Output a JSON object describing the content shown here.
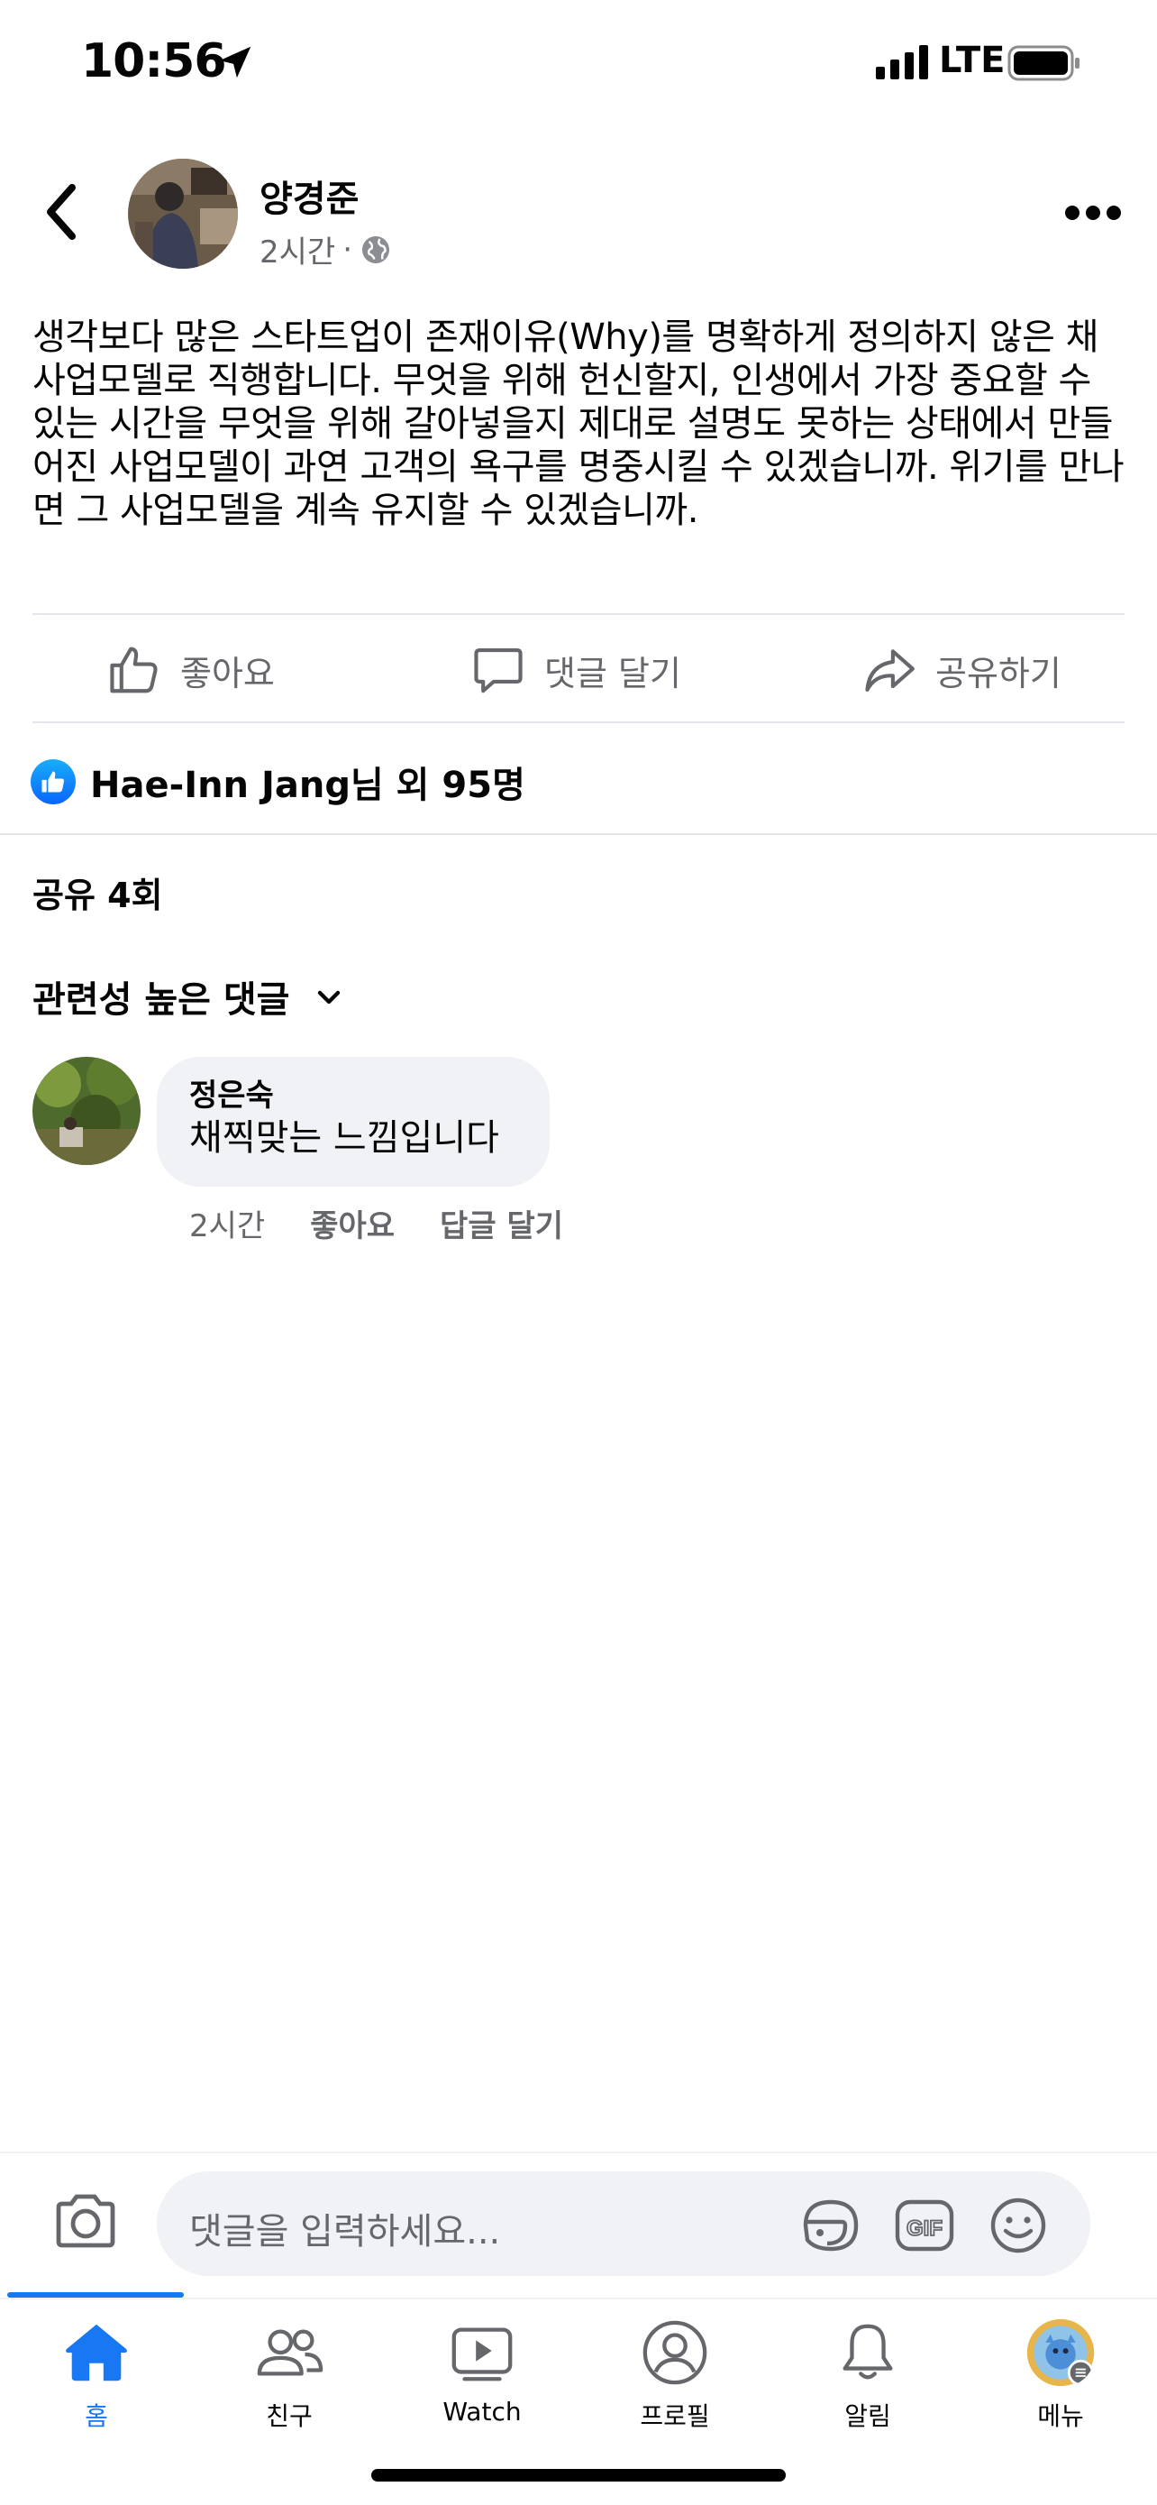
{
  "status_bar": {
    "time": "10:56",
    "network": "LTE"
  },
  "post": {
    "author": "양경준",
    "time": "2시간",
    "separator": "·",
    "body": "생각보다 많은 스타트업이 존재이유(Why)를 명확하게 정의하지 않은 채 사업모델로 직행합니다. 무엇을 위해 헌신할지, 인생에서 가장 중요할 수 있는 시간을 무엇을 위해 갈아넣을지 제대로 설명도 못하는 상태에서 만들어진 사업모델이 과연 고객의 욕구를 명중시킬 수 있겠습니까. 위기를 만나면 그 사업모델을 계속 유지할 수 있겠습니까.",
    "actions": {
      "like": "좋아요",
      "comment": "댓글 달기",
      "share": "공유하기"
    },
    "reactions": {
      "name": "Hae-Inn Jang",
      "suffix": "님 외 95명"
    },
    "shares": "공유 4회",
    "sort_label": "관련성 높은 댓글"
  },
  "comments": [
    {
      "author": "정은숙",
      "text": "채찍맞는 느낌입니다",
      "time": "2시간",
      "like": "좋아요",
      "reply": "답글 달기"
    }
  ],
  "composer": {
    "placeholder": "댓글을 입력하세요..."
  },
  "tabs": [
    {
      "label": "홈",
      "icon": "home-icon",
      "active": true
    },
    {
      "label": "친구",
      "icon": "friends-icon"
    },
    {
      "label": "Watch",
      "icon": "watch-icon"
    },
    {
      "label": "프로필",
      "icon": "profile-icon"
    },
    {
      "label": "알림",
      "icon": "bell-icon"
    },
    {
      "label": "메뉴",
      "icon": "menu-avatar-icon"
    }
  ],
  "colors": {
    "accent": "#1877f2",
    "secondary_text": "#65676b",
    "bubble": "#f0f2f5"
  }
}
